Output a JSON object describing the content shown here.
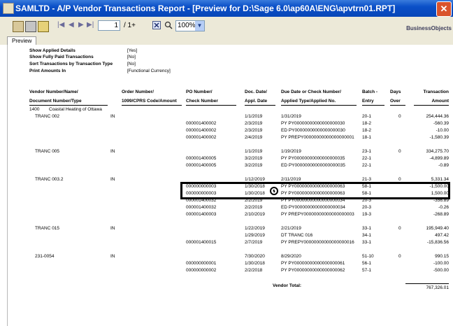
{
  "window": {
    "title": "SAMLTD - A/P Vendor Transactions Report - [Preview for D:\\Sage 6.0\\ap60A\\ENG\\apvtrn01.RPT]"
  },
  "toolbar": {
    "page": "1",
    "page_total": "/ 1+",
    "zoom": "100%",
    "logo": "BusinessObjects"
  },
  "tab": "Preview",
  "options": [
    {
      "label": "Show Applied Details",
      "value": "[Yes]"
    },
    {
      "label": "Show Fully Paid Transactions",
      "value": "[No]"
    },
    {
      "label": "Sort Transactions by Transaction Type",
      "value": "[No]"
    },
    {
      "label": "Print Amounts In",
      "value": "[Functional Currency]"
    }
  ],
  "headers": {
    "vendor1": "Vendor Number/Name/",
    "vendor2": "Document Number/Type",
    "order1": "Order Number/",
    "order2": "1099/CPRS Code/Amount",
    "po1": "PO Number/",
    "po2": "Check Number",
    "doc1": "Doc. Date/",
    "doc2": "Appl. Date",
    "due1": "Due Date or Check Number/",
    "due2": "Applied Type/Applied No.",
    "batch1": "Batch -",
    "batch2": "Entry",
    "days1": "Days",
    "days2": "Over",
    "amt1": "Transaction",
    "amt2": "Amount"
  },
  "vendor": {
    "number": "1400",
    "name": "Coastal Heating of Ottawa"
  },
  "rows": [
    {
      "doc": "TRANC 002",
      "type": "IN",
      "po": "",
      "date": "1/1/2019",
      "due": "1/31/2019",
      "batch": "20-1",
      "days": "0",
      "amount": "254,444.36"
    },
    {
      "doc": "",
      "type": "",
      "po": "000001400002",
      "date": "2/3/2019",
      "due": "PY  PY00000000000000000030",
      "batch": "18-2",
      "days": "",
      "amount": "-560.39"
    },
    {
      "doc": "",
      "type": "",
      "po": "000001400002",
      "date": "2/3/2019",
      "due": "ED  PY00000000000000000030",
      "batch": "18-2",
      "days": "",
      "amount": "-10.00"
    },
    {
      "doc": "",
      "type": "",
      "po": "000001400002",
      "date": "2/4/2019",
      "due": "PY  PREPY00000000000000000001",
      "batch": "18-1",
      "days": "",
      "amount": "-1,580.39"
    },
    {
      "doc": "TRANC 005",
      "type": "IN",
      "po": "",
      "date": "1/1/2019",
      "due": "1/19/2019",
      "batch": "23-1",
      "days": "0",
      "amount": "334,275.70"
    },
    {
      "doc": "",
      "type": "",
      "po": "000001400005",
      "date": "3/2/2019",
      "due": "PY  PY00000000000000000035",
      "batch": "22-1",
      "days": "",
      "amount": "-4,899.89"
    },
    {
      "doc": "",
      "type": "",
      "po": "000001400005",
      "date": "3/2/2019",
      "due": "ED  PY00000000000000000035",
      "batch": "22-1",
      "days": "",
      "amount": "-0.89"
    },
    {
      "doc": "TRANC 003.2",
      "type": "IN",
      "po": "",
      "date": "1/12/2019",
      "due": "2/11/2019",
      "batch": "21-3",
      "days": "0",
      "amount": "5,331.34"
    },
    {
      "doc": "",
      "type": "",
      "po": "000000000003",
      "date": "1/30/2018",
      "due": "PY  PY00000000000000000063",
      "batch": "58-1",
      "days": "",
      "amount": "-1,500.00"
    },
    {
      "doc": "",
      "type": "",
      "po": "000000000003",
      "date": "1/30/2018",
      "due": "PY  PY00000000000000000063",
      "batch": "58-1",
      "days": "",
      "amount": "1,500.00"
    },
    {
      "doc": "",
      "type": "",
      "po": "000001400032",
      "date": "2/2/2019",
      "due": "PY  PY00000000000000000034",
      "batch": "20-3",
      "days": "",
      "amount": "-356.89"
    },
    {
      "doc": "",
      "type": "",
      "po": "000001400032",
      "date": "2/2/2019",
      "due": "ED  PY00000000000000000034",
      "batch": "20-3",
      "days": "",
      "amount": "-0.26"
    },
    {
      "doc": "",
      "type": "",
      "po": "000001400003",
      "date": "2/10/2019",
      "due": "PY  PREPY00000000000000000003",
      "batch": "19-3",
      "days": "",
      "amount": "-268.89"
    },
    {
      "doc": "TRANC 015",
      "type": "IN",
      "po": "",
      "date": "1/22/2019",
      "due": "2/21/2019",
      "batch": "33-1",
      "days": "0",
      "amount": "195,949.40"
    },
    {
      "doc": "",
      "type": "",
      "po": "",
      "date": "1/29/2019",
      "due": "DT  TRANC 016",
      "batch": "34-1",
      "days": "",
      "amount": "497.42"
    },
    {
      "doc": "",
      "type": "",
      "po": "000001400015",
      "date": "2/7/2019",
      "due": "PY  PREPY00000000000000000016",
      "batch": "33-1",
      "days": "",
      "amount": "-15,836.56"
    },
    {
      "doc": "231-0054",
      "type": "IN",
      "po": "",
      "date": "7/30/2020",
      "due": "8/29/2020",
      "batch": "51-10",
      "days": "0",
      "amount": "990.15"
    },
    {
      "doc": "",
      "type": "",
      "po": "000000000001",
      "date": "1/30/2018",
      "due": "PY  PY00000000000000000061",
      "batch": "56-1",
      "days": "",
      "amount": "-100.00"
    },
    {
      "doc": "",
      "type": "",
      "po": "000000000002",
      "date": "2/2/2018",
      "due": "PY  PY00000000000000000062",
      "batch": "57-1",
      "days": "",
      "amount": "-500.00"
    }
  ],
  "totals": {
    "label": "Vendor Total:",
    "amount": "767,326.01"
  }
}
